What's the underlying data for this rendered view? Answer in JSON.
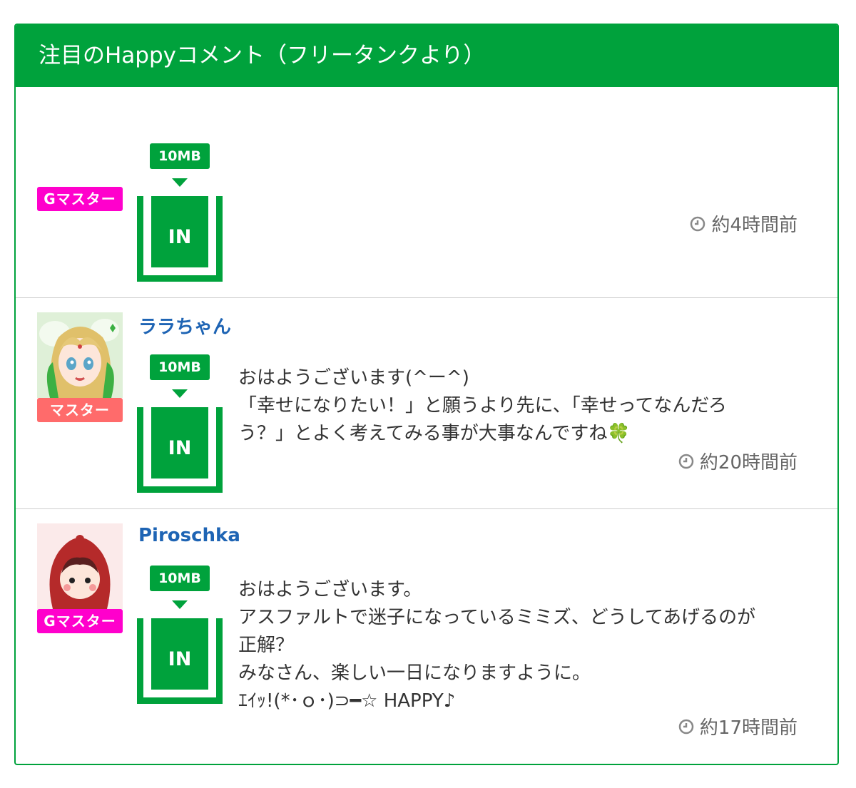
{
  "header": {
    "title": "注目のHappyコメント（フリータンクより）"
  },
  "entries": [
    {
      "badge": "Gマスター",
      "username": "",
      "widget": {
        "size": "10MB",
        "label": "IN"
      },
      "comment_lines": [],
      "time": "約4時間前"
    },
    {
      "badge": "マスター",
      "username": "ララちゃん",
      "widget": {
        "size": "10MB",
        "label": "IN"
      },
      "comment_lines": [
        "おはようございます(^ー^)",
        "「幸せになりたい！」と願うより先に、「幸せってなんだろ",
        "う？」とよく考えてみる事が大事なんですね🍀"
      ],
      "time": "約20時間前"
    },
    {
      "badge": "Gマスター",
      "username": "Piroschka",
      "widget": {
        "size": "10MB",
        "label": "IN"
      },
      "comment_lines": [
        "おはようございます。",
        "アスファルトで迷子になっているミミズ、どうしてあげるのが",
        "正解？",
        "みなさん、楽しい一日になりますように。",
        "ｴｲｯ!(*･ｏ･)⊃━☆ HAPPY♪"
      ],
      "time": "約17時間前"
    }
  ],
  "colors": {
    "brand_green": "#00a23c",
    "g_master_badge": "#ff00cc",
    "master_badge": "#ff6b6b",
    "username_blue": "#1e64b4"
  },
  "icons": {
    "clock": "clock-icon",
    "avatar_1": "anime-girl-avatar",
    "avatar_2": "red-hood-avatar"
  }
}
